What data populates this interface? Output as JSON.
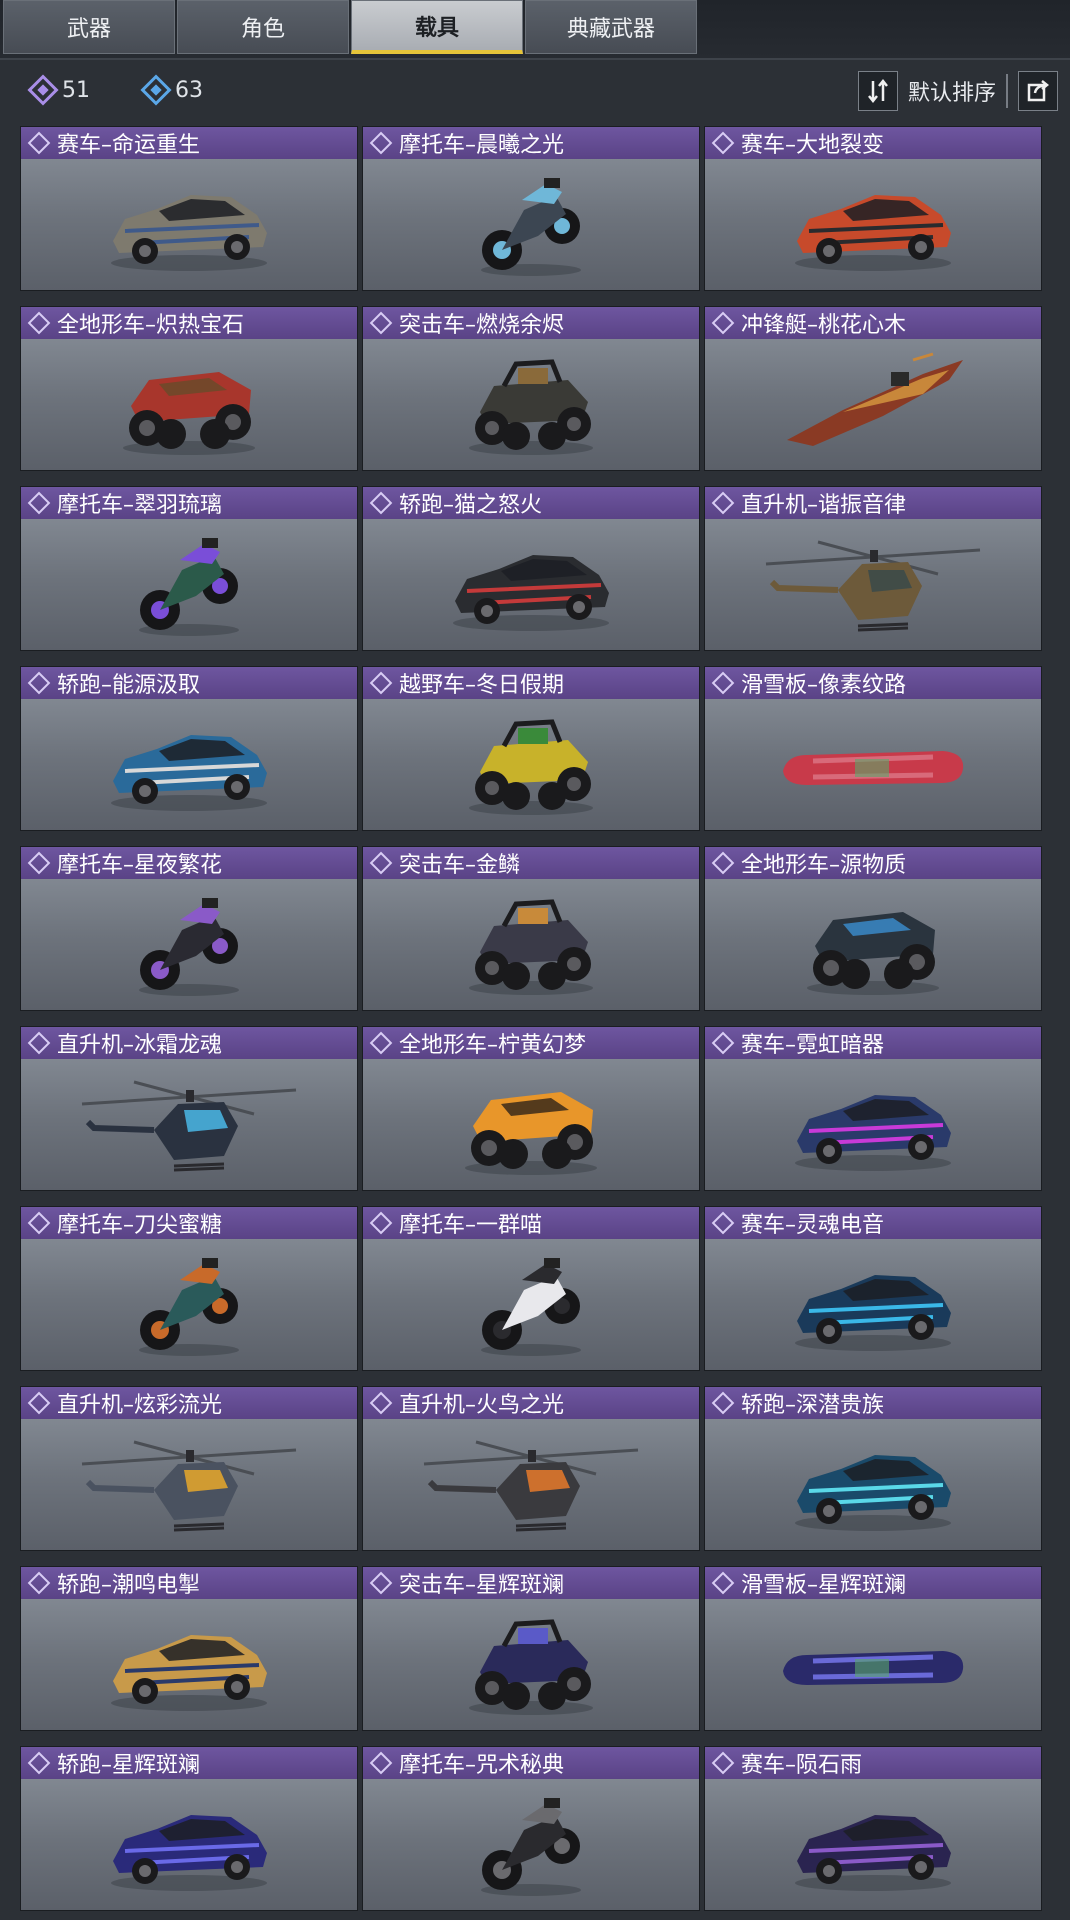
{
  "tabs": [
    {
      "label": "武器"
    },
    {
      "label": "角色"
    },
    {
      "label": "载具"
    },
    {
      "label": "典藏武器"
    }
  ],
  "active_tab": "载具",
  "currency": {
    "purple_count": "51",
    "blue_count": "63"
  },
  "sort": {
    "label": "默认排序"
  },
  "items": [
    {
      "title": "赛车–命运重生",
      "type": "car",
      "colors": [
        "#7e7a6e",
        "#3f5a8a"
      ]
    },
    {
      "title": "摩托车–晨曦之光",
      "type": "moto",
      "colors": [
        "#3c4652",
        "#6fb7d8"
      ]
    },
    {
      "title": "赛车–大地裂变",
      "type": "car",
      "colors": [
        "#c74a2b",
        "#2a2b2e"
      ]
    },
    {
      "title": "全地形车–炽热宝石",
      "type": "atv",
      "colors": [
        "#a8362c",
        "#6b4a2a"
      ]
    },
    {
      "title": "突击车–燃烧余烬",
      "type": "buggy",
      "colors": [
        "#3a3a36",
        "#8a6a3a"
      ]
    },
    {
      "title": "冲锋艇–桃花心木",
      "type": "boat",
      "colors": [
        "#8a3a24",
        "#c8873a"
      ]
    },
    {
      "title": "摩托车–翠羽琉璃",
      "type": "moto",
      "colors": [
        "#2b5a4a",
        "#7a4ed8"
      ]
    },
    {
      "title": "轿跑–猫之怒火",
      "type": "car",
      "colors": [
        "#2a2c30",
        "#c43a3a"
      ]
    },
    {
      "title": "直升机–谐振音律",
      "type": "heli",
      "colors": [
        "#6d5a3a",
        "#3a4a4a"
      ]
    },
    {
      "title": "轿跑–能源汲取",
      "type": "car",
      "colors": [
        "#2a6a9a",
        "#d8d8d8"
      ]
    },
    {
      "title": "越野车–冬日假期",
      "type": "buggy",
      "colors": [
        "#c8b22a",
        "#3a8a3a"
      ]
    },
    {
      "title": "滑雪板–像素纹路",
      "type": "board",
      "colors": [
        "#c83a4a",
        "#d86a7a"
      ]
    },
    {
      "title": "摩托车–星夜繁花",
      "type": "moto",
      "colors": [
        "#2a2a32",
        "#8a5ac8"
      ]
    },
    {
      "title": "突击车–金鳞",
      "type": "buggy",
      "colors": [
        "#3a3a48",
        "#c88a3a"
      ]
    },
    {
      "title": "全地形车–源物质",
      "type": "atv",
      "colors": [
        "#2a343e",
        "#3a8ac8"
      ]
    },
    {
      "title": "直升机–冰霜龙魂",
      "type": "heli",
      "colors": [
        "#2a3240",
        "#4ab8e8"
      ]
    },
    {
      "title": "全地形车–柠黄幻梦",
      "type": "atv",
      "colors": [
        "#e8962a",
        "#3a2a1a"
      ]
    },
    {
      "title": "赛车–霓虹暗器",
      "type": "car",
      "colors": [
        "#2a3a6a",
        "#c83ad8"
      ]
    },
    {
      "title": "摩托车–刀尖蜜糖",
      "type": "moto",
      "colors": [
        "#2a5a5a",
        "#c86a2a"
      ]
    },
    {
      "title": "摩托车–一群喵",
      "type": "moto",
      "colors": [
        "#e8e8ec",
        "#2a2a2e"
      ]
    },
    {
      "title": "赛车–灵魂电音",
      "type": "car",
      "colors": [
        "#1a3a5a",
        "#3ab8e8"
      ]
    },
    {
      "title": "直升机–炫彩流光",
      "type": "heli",
      "colors": [
        "#4a5260",
        "#e8a82a"
      ]
    },
    {
      "title": "直升机–火鸟之光",
      "type": "heli",
      "colors": [
        "#3a3a3e",
        "#e87a2a"
      ]
    },
    {
      "title": "轿跑–深潜贵族",
      "type": "car",
      "colors": [
        "#1a4a6a",
        "#5ad8e8"
      ]
    },
    {
      "title": "轿跑–潮鸣电掣",
      "type": "car",
      "colors": [
        "#c89a4a",
        "#2a3a6a"
      ]
    },
    {
      "title": "突击车–星辉斑斓",
      "type": "buggy",
      "colors": [
        "#2a2a5a",
        "#5a5ac8"
      ]
    },
    {
      "title": "滑雪板–星辉斑斓",
      "type": "board",
      "colors": [
        "#2a2a6a",
        "#6a6ad8"
      ]
    },
    {
      "title": "轿跑–星辉斑斓",
      "type": "car",
      "colors": [
        "#2a2a7a",
        "#6a6ae8"
      ]
    },
    {
      "title": "摩托车–咒术秘典",
      "type": "moto",
      "colors": [
        "#2a2a2e",
        "#6a6a6e"
      ]
    },
    {
      "title": "赛车–陨石雨",
      "type": "car",
      "colors": [
        "#2a2450",
        "#8a5ac8"
      ]
    }
  ]
}
